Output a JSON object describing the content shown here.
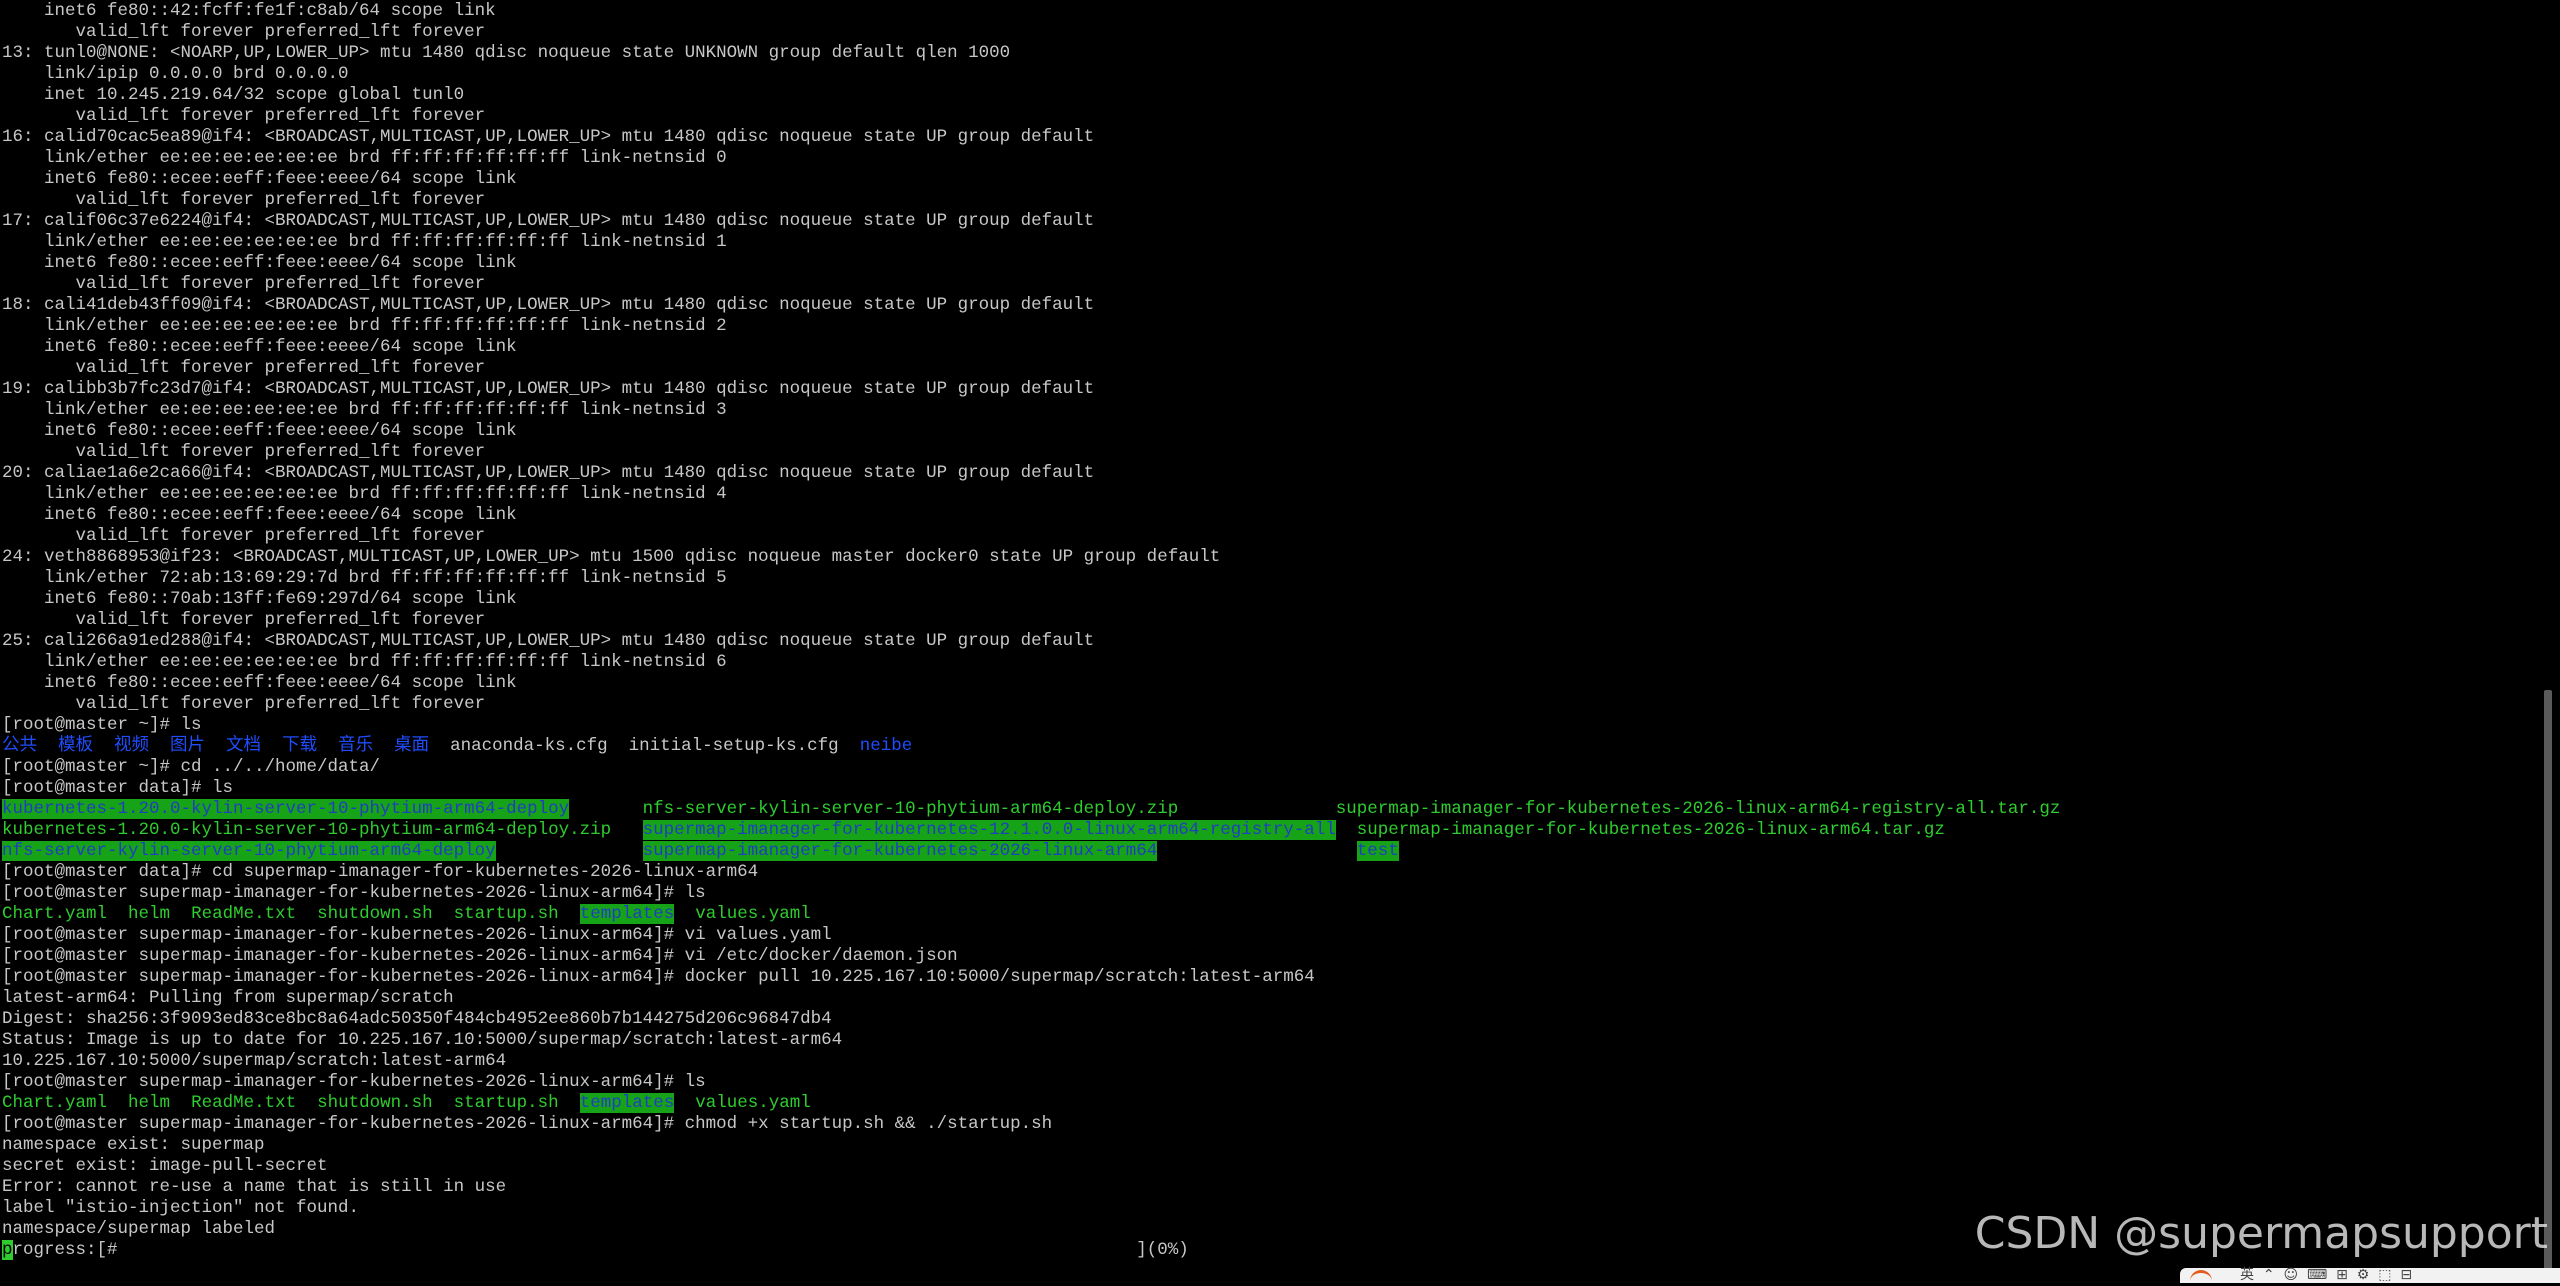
{
  "terminal": {
    "watermark": "CSDN @supermapsupport",
    "tray_logo_icon": "sogou-input-icon",
    "tray_icons_text": "英  ⌃  ☺  ⌨  ⊞  ⚙  ⬚  ⊟",
    "colors": {
      "background": "#000000",
      "text": "#c7c7c7",
      "directory_blue": "#1f4dff",
      "executable_green": "#2ecc2e",
      "highlight_bg": "#17a317"
    },
    "lines": [
      [
        [
          "    inet6 fe80::42:fcff:fe1f:c8ab/64 scope link",
          ""
        ]
      ],
      [
        [
          "       valid_lft forever preferred_lft forever",
          ""
        ]
      ],
      [
        [
          "13: tunl0@NONE: <NOARP,UP,LOWER_UP> mtu 1480 qdisc noqueue state UNKNOWN group default qlen 1000",
          ""
        ]
      ],
      [
        [
          "    link/ipip 0.0.0.0 brd 0.0.0.0",
          ""
        ]
      ],
      [
        [
          "    inet 10.245.219.64/32 scope global tunl0",
          ""
        ]
      ],
      [
        [
          "       valid_lft forever preferred_lft forever",
          ""
        ]
      ],
      [
        [
          "16: calid70cac5ea89@if4: <BROADCAST,MULTICAST,UP,LOWER_UP> mtu 1480 qdisc noqueue state UP group default",
          ""
        ]
      ],
      [
        [
          "    link/ether ee:ee:ee:ee:ee:ee brd ff:ff:ff:ff:ff:ff link-netnsid 0",
          ""
        ]
      ],
      [
        [
          "    inet6 fe80::ecee:eeff:feee:eeee/64 scope link",
          ""
        ]
      ],
      [
        [
          "       valid_lft forever preferred_lft forever",
          ""
        ]
      ],
      [
        [
          "17: calif06c37e6224@if4: <BROADCAST,MULTICAST,UP,LOWER_UP> mtu 1480 qdisc noqueue state UP group default",
          ""
        ]
      ],
      [
        [
          "    link/ether ee:ee:ee:ee:ee:ee brd ff:ff:ff:ff:ff:ff link-netnsid 1",
          ""
        ]
      ],
      [
        [
          "    inet6 fe80::ecee:eeff:feee:eeee/64 scope link",
          ""
        ]
      ],
      [
        [
          "       valid_lft forever preferred_lft forever",
          ""
        ]
      ],
      [
        [
          "18: cali41deb43ff09@if4: <BROADCAST,MULTICAST,UP,LOWER_UP> mtu 1480 qdisc noqueue state UP group default",
          ""
        ]
      ],
      [
        [
          "    link/ether ee:ee:ee:ee:ee:ee brd ff:ff:ff:ff:ff:ff link-netnsid 2",
          ""
        ]
      ],
      [
        [
          "    inet6 fe80::ecee:eeff:feee:eeee/64 scope link",
          ""
        ]
      ],
      [
        [
          "       valid_lft forever preferred_lft forever",
          ""
        ]
      ],
      [
        [
          "19: calibb3b7fc23d7@if4: <BROADCAST,MULTICAST,UP,LOWER_UP> mtu 1480 qdisc noqueue state UP group default",
          ""
        ]
      ],
      [
        [
          "    link/ether ee:ee:ee:ee:ee:ee brd ff:ff:ff:ff:ff:ff link-netnsid 3",
          ""
        ]
      ],
      [
        [
          "    inet6 fe80::ecee:eeff:feee:eeee/64 scope link",
          ""
        ]
      ],
      [
        [
          "       valid_lft forever preferred_lft forever",
          ""
        ]
      ],
      [
        [
          "20: caliae1a6e2ca66@if4: <BROADCAST,MULTICAST,UP,LOWER_UP> mtu 1480 qdisc noqueue state UP group default",
          ""
        ]
      ],
      [
        [
          "    link/ether ee:ee:ee:ee:ee:ee brd ff:ff:ff:ff:ff:ff link-netnsid 4",
          ""
        ]
      ],
      [
        [
          "    inet6 fe80::ecee:eeff:feee:eeee/64 scope link",
          ""
        ]
      ],
      [
        [
          "       valid_lft forever preferred_lft forever",
          ""
        ]
      ],
      [
        [
          "24: veth8868953@if23: <BROADCAST,MULTICAST,UP,LOWER_UP> mtu 1500 qdisc noqueue master docker0 state UP group default",
          ""
        ]
      ],
      [
        [
          "    link/ether 72:ab:13:69:29:7d brd ff:ff:ff:ff:ff:ff link-netnsid 5",
          ""
        ]
      ],
      [
        [
          "    inet6 fe80::70ab:13ff:fe69:297d/64 scope link",
          ""
        ]
      ],
      [
        [
          "       valid_lft forever preferred_lft forever",
          ""
        ]
      ],
      [
        [
          "25: cali266a91ed288@if4: <BROADCAST,MULTICAST,UP,LOWER_UP> mtu 1480 qdisc noqueue state UP group default",
          ""
        ]
      ],
      [
        [
          "    link/ether ee:ee:ee:ee:ee:ee brd ff:ff:ff:ff:ff:ff link-netnsid 6",
          ""
        ]
      ],
      [
        [
          "    inet6 fe80::ecee:eeff:feee:eeee/64 scope link",
          ""
        ]
      ],
      [
        [
          "       valid_lft forever preferred_lft forever",
          ""
        ]
      ],
      [
        [
          "[root@master ~]# ls",
          ""
        ]
      ],
      [
        [
          "公共",
          "blue"
        ],
        [
          "  ",
          ""
        ],
        [
          "模板",
          "blue"
        ],
        [
          "  ",
          ""
        ],
        [
          "视频",
          "blue"
        ],
        [
          "  ",
          ""
        ],
        [
          "图片",
          "blue"
        ],
        [
          "  ",
          ""
        ],
        [
          "文档",
          "blue"
        ],
        [
          "  ",
          ""
        ],
        [
          "下载",
          "blue"
        ],
        [
          "  ",
          ""
        ],
        [
          "音乐",
          "blue"
        ],
        [
          "  ",
          ""
        ],
        [
          "桌面",
          "blue"
        ],
        [
          "  anaconda-ks.cfg  initial-setup-ks.cfg  ",
          ""
        ],
        [
          "neibe",
          "blue"
        ]
      ],
      [
        [
          "[root@master ~]# cd ../../home/data/",
          ""
        ]
      ],
      [
        [
          "[root@master data]# ls",
          ""
        ]
      ],
      [
        [
          "kubernetes-1.20.0-kylin-server-10-phytium-arm64-deploy",
          "hl"
        ],
        [
          "       ",
          ""
        ],
        [
          "nfs-server-kylin-server-10-phytium-arm64-deploy.zip",
          "green"
        ],
        [
          "               ",
          ""
        ],
        [
          "supermap-imanager-for-kubernetes-2026-linux-arm64-registry-all.tar.gz",
          "green"
        ]
      ],
      [
        [
          "kubernetes-1.20.0-kylin-server-10-phytium-arm64-deploy.zip",
          "green"
        ],
        [
          "   ",
          ""
        ],
        [
          "supermap-imanager-for-kubernetes-12.1.0.0-linux-arm64-registry-all",
          "hl"
        ],
        [
          "  ",
          ""
        ],
        [
          "supermap-imanager-for-kubernetes-2026-linux-arm64.tar.gz",
          "green"
        ]
      ],
      [
        [
          "nfs-server-kylin-server-10-phytium-arm64-deploy",
          "hl"
        ],
        [
          "              ",
          ""
        ],
        [
          "supermap-imanager-for-kubernetes-2026-linux-arm64",
          "hl"
        ],
        [
          "                   ",
          ""
        ],
        [
          "test",
          "hl"
        ]
      ],
      [
        [
          "[root@master data]# cd supermap-imanager-for-kubernetes-2026-linux-arm64",
          ""
        ]
      ],
      [
        [
          "[root@master supermap-imanager-for-kubernetes-2026-linux-arm64]# ls",
          ""
        ]
      ],
      [
        [
          "Chart.yaml",
          "green"
        ],
        [
          "  ",
          ""
        ],
        [
          "helm",
          "green"
        ],
        [
          "  ",
          ""
        ],
        [
          "ReadMe.txt",
          "green"
        ],
        [
          "  ",
          ""
        ],
        [
          "shutdown.sh",
          "green"
        ],
        [
          "  ",
          ""
        ],
        [
          "startup.sh",
          "green"
        ],
        [
          "  ",
          ""
        ],
        [
          "templates",
          "hl"
        ],
        [
          "  ",
          ""
        ],
        [
          "values.yaml",
          "green"
        ]
      ],
      [
        [
          "[root@master supermap-imanager-for-kubernetes-2026-linux-arm64]# vi values.yaml",
          ""
        ]
      ],
      [
        [
          "[root@master supermap-imanager-for-kubernetes-2026-linux-arm64]# vi /etc/docker/daemon.json",
          ""
        ]
      ],
      [
        [
          "[root@master supermap-imanager-for-kubernetes-2026-linux-arm64]# docker pull 10.225.167.10:5000/supermap/scratch:latest-arm64",
          ""
        ]
      ],
      [
        [
          "latest-arm64: Pulling from supermap/scratch",
          ""
        ]
      ],
      [
        [
          "Digest: sha256:3f9093ed83ce8bc8a64adc50350f484cb4952ee860b7b144275d206c96847db4",
          ""
        ]
      ],
      [
        [
          "Status: Image is up to date for 10.225.167.10:5000/supermap/scratch:latest-arm64",
          ""
        ]
      ],
      [
        [
          "10.225.167.10:5000/supermap/scratch:latest-arm64",
          ""
        ]
      ],
      [
        [
          "[root@master supermap-imanager-for-kubernetes-2026-linux-arm64]# ls",
          ""
        ]
      ],
      [
        [
          "Chart.yaml",
          "green"
        ],
        [
          "  ",
          ""
        ],
        [
          "helm",
          "green"
        ],
        [
          "  ",
          ""
        ],
        [
          "ReadMe.txt",
          "green"
        ],
        [
          "  ",
          ""
        ],
        [
          "shutdown.sh",
          "green"
        ],
        [
          "  ",
          ""
        ],
        [
          "startup.sh",
          "green"
        ],
        [
          "  ",
          ""
        ],
        [
          "templates",
          "hl"
        ],
        [
          "  ",
          ""
        ],
        [
          "values.yaml",
          "green"
        ]
      ],
      [
        [
          "[root@master supermap-imanager-for-kubernetes-2026-linux-arm64]# chmod +x startup.sh && ./startup.sh",
          ""
        ]
      ],
      [
        [
          "namespace exist: supermap",
          ""
        ]
      ],
      [
        [
          "secret exist: image-pull-secret",
          ""
        ]
      ],
      [
        [
          "Error: cannot re-use a name that is still in use",
          ""
        ]
      ],
      [
        [
          "label \"istio-injection\" not found.",
          ""
        ]
      ],
      [
        [
          "namespace/supermap labeled",
          ""
        ]
      ],
      [
        [
          "p",
          "cursor"
        ],
        [
          "rogress:[#                                                                                                 ](0%)",
          ""
        ]
      ]
    ]
  }
}
